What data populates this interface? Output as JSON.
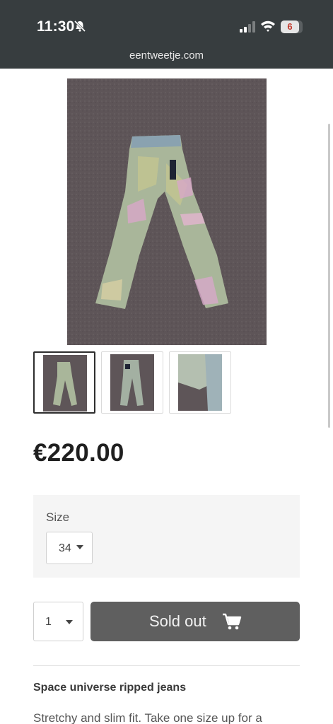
{
  "status_bar": {
    "time": "11:30",
    "battery_level": "6"
  },
  "browser": {
    "url": "eentweetje.com"
  },
  "gallery": {
    "main_image_icon": "jeans-photo",
    "next_icon": "chevron-right-icon",
    "thumbnails": [
      {
        "icon": "jeans-front-photo",
        "active": true
      },
      {
        "icon": "jeans-back-photo",
        "active": false
      },
      {
        "icon": "jeans-detail-photo",
        "active": false
      }
    ]
  },
  "product": {
    "price": "€220.00",
    "size_label": "Size",
    "size_value": "34",
    "quantity_value": "1",
    "sold_out_label": "Sold out",
    "title": "Space universe ripped jeans",
    "description": "Stretchy and slim fit. Take one size up for a"
  },
  "colors": {
    "topbar": "#373d3f",
    "button": "#5f5f5f",
    "panel": "#f5f5f5"
  }
}
